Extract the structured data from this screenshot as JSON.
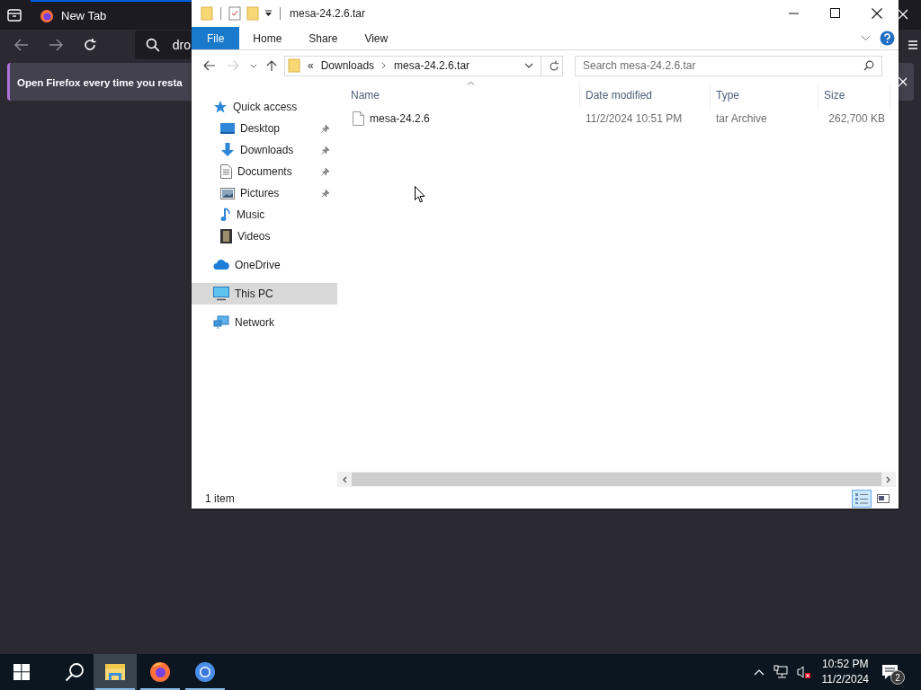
{
  "browser": {
    "tab": {
      "title": "New Tab"
    },
    "address": {
      "value": "dro"
    },
    "notification": {
      "text": "Open Firefox every time you resta"
    }
  },
  "explorer": {
    "title": "mesa-24.2.6.tar",
    "ribbon_tabs": [
      {
        "label": "File",
        "selected": true
      },
      {
        "label": "Home",
        "selected": false
      },
      {
        "label": "Share",
        "selected": false
      },
      {
        "label": "View",
        "selected": false
      }
    ],
    "breadcrumb": {
      "overflow": "«",
      "items": [
        "Downloads",
        "mesa-24.2.6.tar"
      ]
    },
    "search": {
      "placeholder": "Search mesa-24.2.6.tar"
    },
    "nav": [
      {
        "label": "Quick access",
        "kind": "star",
        "selected": false,
        "children": [
          {
            "label": "Desktop",
            "kind": "desktop",
            "pinned": true,
            "selected": false
          },
          {
            "label": "Downloads",
            "kind": "downloads",
            "pinned": true,
            "selected": false
          },
          {
            "label": "Documents",
            "kind": "documents",
            "pinned": true,
            "selected": false
          },
          {
            "label": "Pictures",
            "kind": "pictures",
            "pinned": true,
            "selected": false
          },
          {
            "label": "Music",
            "kind": "music",
            "pinned": false,
            "selected": false
          },
          {
            "label": "Videos",
            "kind": "videos",
            "pinned": false,
            "selected": false
          }
        ]
      },
      {
        "label": "OneDrive",
        "kind": "cloud",
        "selected": false
      },
      {
        "label": "This PC",
        "kind": "pc",
        "selected": true
      },
      {
        "label": "Network",
        "kind": "network",
        "selected": false
      }
    ],
    "columns": [
      {
        "label": "Name",
        "sorted": true
      },
      {
        "label": "Date modified",
        "sorted": false
      },
      {
        "label": "Type",
        "sorted": false
      },
      {
        "label": "Size",
        "sorted": false
      }
    ],
    "rows": [
      {
        "name": "mesa-24.2.6",
        "date": "11/2/2024 10:51 PM",
        "type": "tar Archive",
        "size": "262,700 KB",
        "selected": false
      }
    ],
    "status": "1 item",
    "view_buttons": [
      {
        "kind": "details",
        "selected": true
      },
      {
        "kind": "tiles",
        "selected": false
      }
    ]
  },
  "taskbar": {
    "apps": [
      {
        "kind": "explorer",
        "active": true,
        "running": true
      },
      {
        "kind": "firefox",
        "active": false,
        "running": true
      },
      {
        "kind": "chrome",
        "active": false,
        "running": true
      }
    ],
    "clock": {
      "time": "10:52 PM",
      "date": "11/2/2024"
    },
    "notifications": {
      "count": "2"
    }
  }
}
